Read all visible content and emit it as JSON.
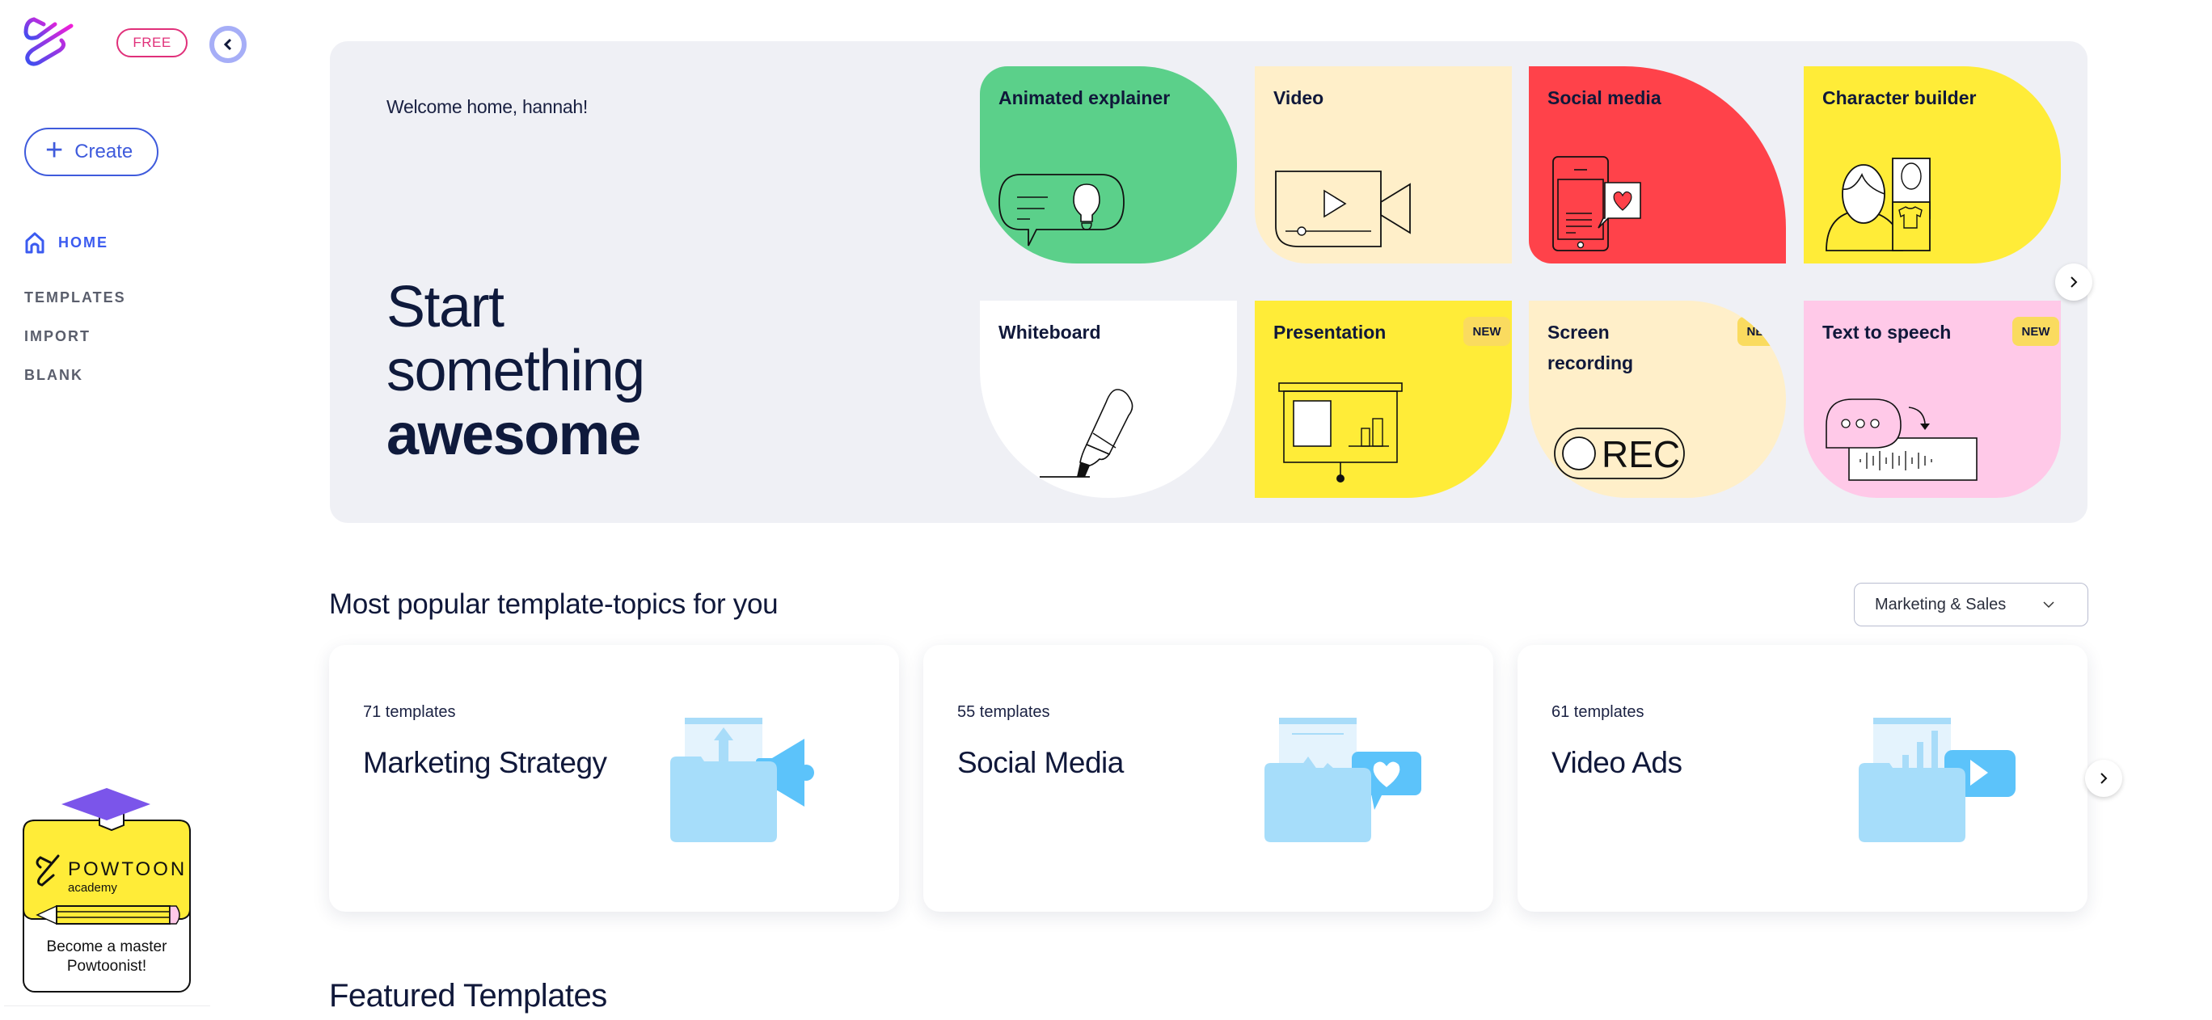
{
  "sidebar": {
    "plan_badge": "FREE",
    "create_label": "Create",
    "nav": [
      {
        "label": "HOME",
        "icon": "home-icon",
        "active": true
      },
      {
        "label": "TEMPLATES",
        "active": false
      },
      {
        "label": "IMPORT",
        "active": false
      },
      {
        "label": "BLANK",
        "active": false
      }
    ],
    "academy": {
      "brand": "POWTOON",
      "sub": "academy",
      "line1": "Become a master",
      "line2": "Powtoonist!"
    }
  },
  "hero": {
    "welcome": "Welcome home, hannah!",
    "headline_line1": "Start",
    "headline_line2": "something",
    "headline_line3": "awesome",
    "tiles": [
      {
        "title": "Animated explainer",
        "color": "#5bd08a",
        "new": false
      },
      {
        "title": "Video",
        "color": "#ffefc9",
        "new": false
      },
      {
        "title": "Social media",
        "color": "#ff424a",
        "new": false
      },
      {
        "title": "Character builder",
        "color": "#ffec38",
        "new": false
      },
      {
        "title": "Whiteboard",
        "color": "#ffffff",
        "new": false
      },
      {
        "title": "Presentation",
        "color": "#ffec38",
        "new": true
      },
      {
        "title": "Screen recording",
        "color": "#ffefc9",
        "new": true
      },
      {
        "title": "Text to speech",
        "color": "#ffc9e8",
        "new": true
      }
    ],
    "new_badge": "NEW",
    "rec_label": "REC"
  },
  "topics": {
    "title": "Most popular template-topics for you",
    "dropdown_value": "Marketing & Sales",
    "cards": [
      {
        "count": "71 templates",
        "name": "Marketing Strategy"
      },
      {
        "count": "55 templates",
        "name": "Social Media"
      },
      {
        "count": "61 templates",
        "name": "Video Ads"
      }
    ]
  },
  "featured": {
    "title": "Featured Templates"
  },
  "colors": {
    "accent": "#3b5bf0",
    "badge_pink": "#e0307a",
    "hero_bg": "#eff0f5",
    "text_dark": "#10183a"
  }
}
